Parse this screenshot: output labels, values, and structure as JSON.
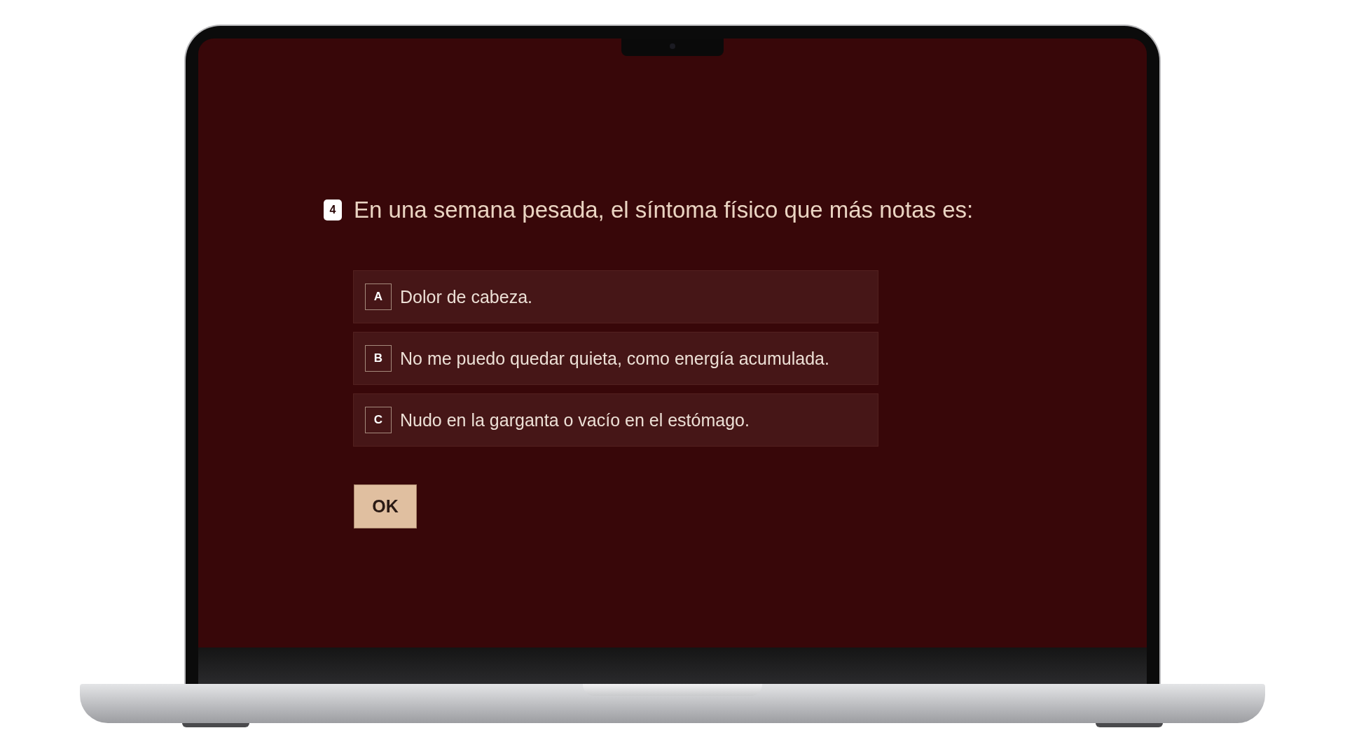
{
  "question": {
    "number": "4",
    "text": "En una semana pesada, el síntoma físico que más notas es:"
  },
  "options": [
    {
      "letter": "A",
      "text": "Dolor de cabeza.",
      "selected": false
    },
    {
      "letter": "B",
      "text": "No me puedo quedar quieta, como energía acumulada.",
      "selected": false
    },
    {
      "letter": "C",
      "text": "Nudo en la garganta o vacío en el estómago.",
      "selected": false
    }
  ],
  "submit_button": {
    "label": "OK"
  }
}
